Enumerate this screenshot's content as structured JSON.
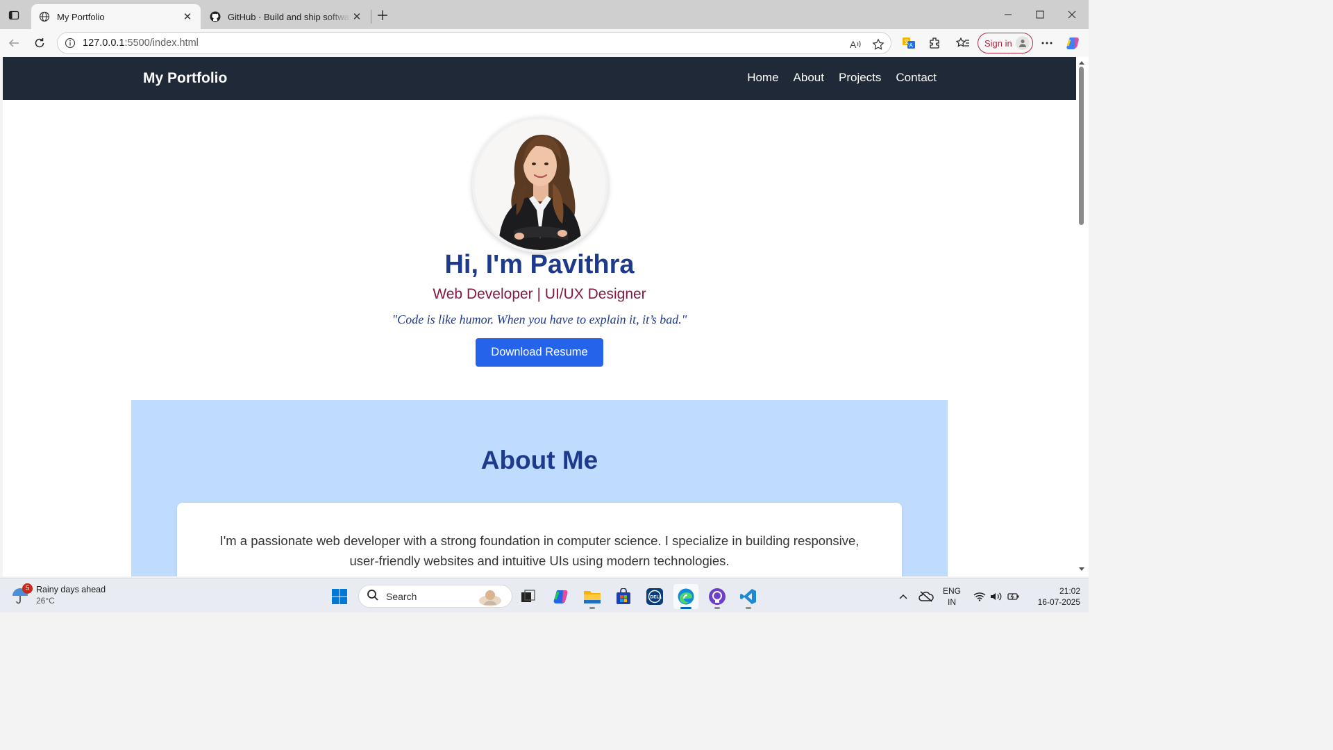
{
  "browser": {
    "tabs": [
      {
        "title": "My Portfolio",
        "favicon": "globe-icon",
        "active": true
      },
      {
        "title": "GitHub · Build and ship software on a single, collaborative platform",
        "favicon": "github-icon",
        "active": false
      }
    ],
    "address": {
      "host": "127.0.0.1",
      "path": ":5500/index.html"
    },
    "signin_label": "Sign in"
  },
  "site": {
    "brand": "My Portfolio",
    "nav": [
      "Home",
      "About",
      "Projects",
      "Contact"
    ],
    "hero": {
      "heading": "Hi, I'm Pavithra",
      "subtitle": "Web Developer | UI/UX Designer",
      "quote": "\"Code is like humor. When you have to explain it, it’s bad.\"",
      "button": "Download Resume"
    },
    "about": {
      "heading": "About Me",
      "text": "I'm a passionate web developer with a strong foundation in computer science. I specialize in building responsive, user-friendly websites and intuitive UIs using modern technologies."
    }
  },
  "taskbar": {
    "weather": {
      "title": "Rainy days ahead",
      "temp": "26°C",
      "badge": "5"
    },
    "search_label": "Search",
    "lang": {
      "line1": "ENG",
      "line2": "IN"
    },
    "clock": {
      "time": "21:02",
      "date": "16-07-2025"
    }
  },
  "colors": {
    "nav_bg": "#1f2937",
    "heading": "#1e3a8a",
    "subtitle": "#831843",
    "button": "#2563eb",
    "about_bg": "#bfdbfe",
    "signin": "#b0273f"
  }
}
